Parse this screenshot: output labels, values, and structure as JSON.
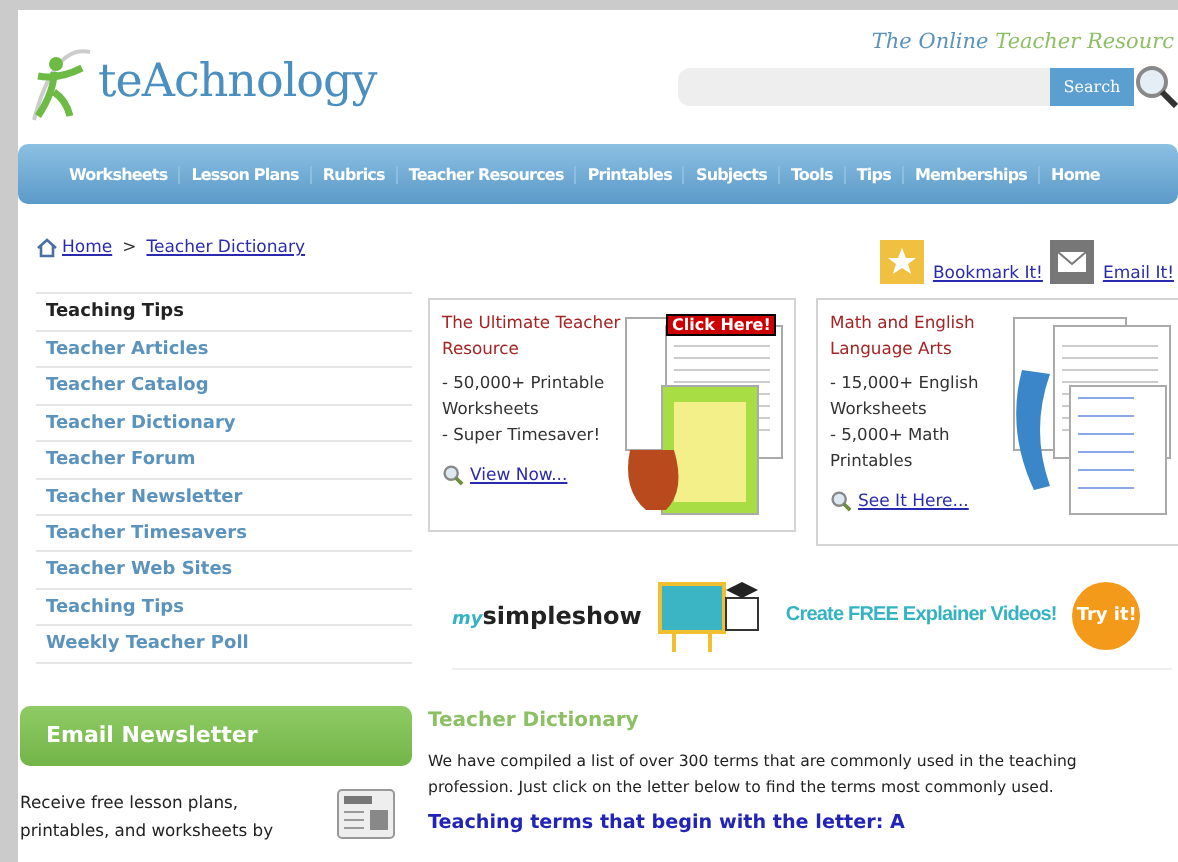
{
  "header": {
    "logo": "teAchnology",
    "tagline_1": "The Online",
    "tagline_2": "Teacher Resourc",
    "search": {
      "button": "Search"
    }
  },
  "nav": [
    "Worksheets",
    "Lesson Plans",
    "Rubrics",
    "Teacher Resources",
    "Printables",
    "Subjects",
    "Tools",
    "Tips",
    "Memberships",
    "Home"
  ],
  "breadcrumb": [
    {
      "label": "Home"
    },
    {
      "label": "Teacher Dictionary"
    }
  ],
  "breadcrumb_separator": ">",
  "actions": [
    {
      "label": "Bookmark It!",
      "kind": "bookmark"
    },
    {
      "label": "Email It!",
      "kind": "email"
    }
  ],
  "sidebar": {
    "title": "Teaching Tips",
    "items": [
      {
        "label": "Teacher Articles"
      },
      {
        "label": "Teacher Catalog"
      },
      {
        "label": "Teacher Dictionary"
      },
      {
        "label": "Teacher Forum"
      },
      {
        "label": "Teacher Newsletter"
      },
      {
        "label": "Teacher Timesavers"
      },
      {
        "label": "Teacher Web Sites"
      },
      {
        "label": "Teaching Tips"
      },
      {
        "label": "Weekly Teacher Poll"
      }
    ]
  },
  "newsletter": {
    "title": "Email Newsletter",
    "text": "Receive free lesson plans, printables, and worksheets by"
  },
  "promos": [
    {
      "title": "The Ultimate Teacher Resource",
      "lines": [
        "- 50,000+ Printable Worksheets",
        "- Super Timesaver!"
      ],
      "link": "View Now...",
      "badge": "Click Here!"
    },
    {
      "title": "Math and English Language Arts",
      "lines": [
        "- 15,000+ English Worksheets",
        "- 5,000+ Math Printables"
      ],
      "link": "See It Here..."
    }
  ],
  "ad": {
    "brand_prefix": "my",
    "brand": "simpleshow",
    "slogan": "Create FREE Explainer Videos!",
    "cta": "Try it!"
  },
  "article": {
    "title": "Teacher Dictionary",
    "intro": "We have compiled a list of over 300 terms that are commonly used in the teaching profession. Just click on the letter below to find the terms most commonly used.",
    "subheading": "Teaching terms that begin with the letter: A"
  }
}
